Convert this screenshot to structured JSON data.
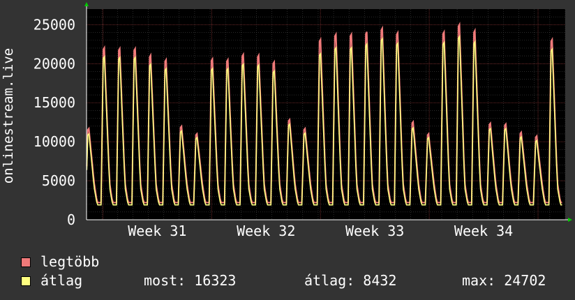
{
  "chart_data": {
    "type": "line",
    "ylabel": "onlinestream.live",
    "ylim": [
      0,
      27000
    ],
    "yticks": [
      0,
      5000,
      10000,
      15000,
      20000,
      25000
    ],
    "xticks": [
      {
        "label": "Week 31",
        "x": 31
      },
      {
        "label": "Week 32",
        "x": 32
      },
      {
        "label": "Week 33",
        "x": 33
      },
      {
        "label": "Week 34",
        "x": 34
      }
    ],
    "xlim": [
      30.35,
      34.75
    ],
    "grid": true,
    "days": 31,
    "series": [
      {
        "name": "legtöbb",
        "color": "#f07a7a",
        "daily_peaks": [
          12000,
          22800,
          22700,
          22700,
          21800,
          21200,
          12300,
          11300,
          21300,
          21200,
          21900,
          21800,
          20900,
          13200,
          12000,
          23900,
          24600,
          24600,
          24900,
          25400,
          24800,
          12900,
          11300,
          24900,
          25900,
          25100,
          12700,
          12600,
          11500,
          11000,
          23900,
          25300
        ],
        "daily_min": 2200
      },
      {
        "name": "átlag",
        "color": "#ffff80",
        "daily_peaks": [
          11300,
          21600,
          21500,
          21500,
          20600,
          20000,
          11700,
          10800,
          20000,
          20000,
          20600,
          20500,
          19700,
          12600,
          11400,
          22000,
          22800,
          22800,
          23300,
          24000,
          23400,
          12100,
          10800,
          23500,
          24300,
          23600,
          12000,
          12000,
          10900,
          10400,
          22600,
          24300
        ],
        "daily_min": 1900
      }
    ]
  },
  "legend": {
    "items": [
      {
        "label": "legtöbb",
        "color": "#f07a7a"
      },
      {
        "label": "átlag",
        "color": "#ffff80"
      }
    ]
  },
  "stats": {
    "most": "most: 16323",
    "atlag": "átlag: 8432",
    "max": "max: 24702"
  }
}
